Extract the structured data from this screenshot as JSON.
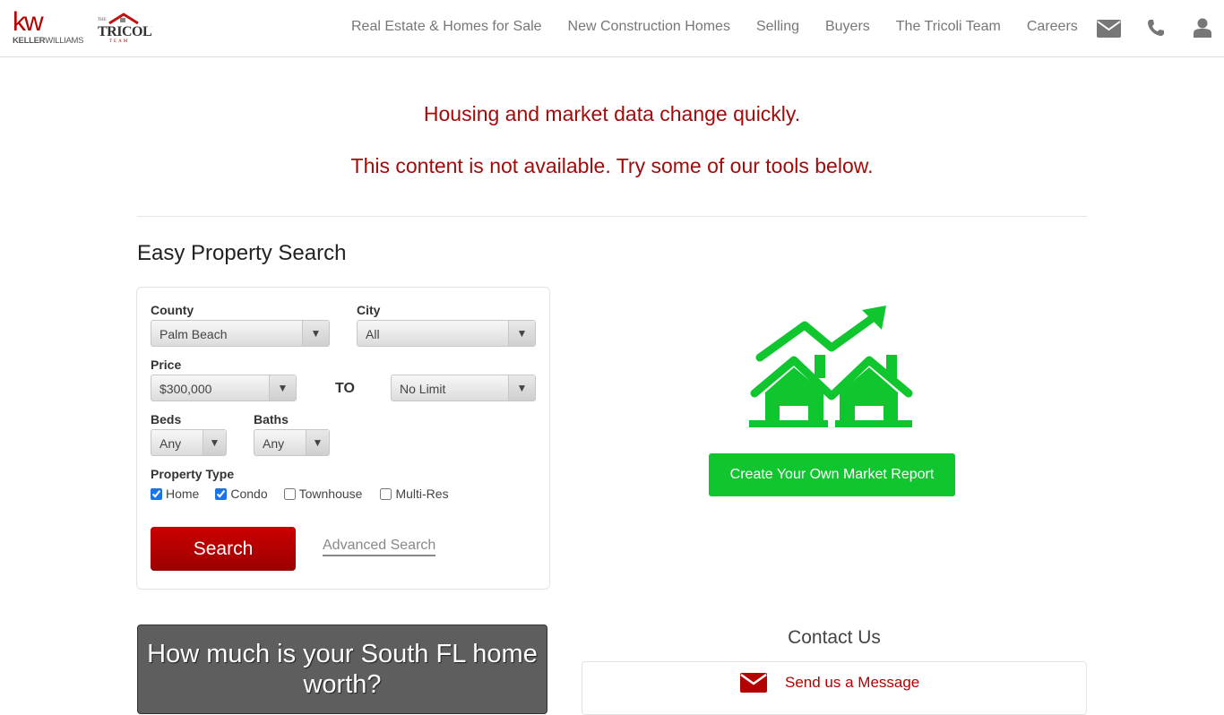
{
  "header": {
    "logo_kw_mark": "kw",
    "logo_kw_name_bold": "KELLER",
    "logo_kw_name_light": "WILLIAMS",
    "logo_tricoli_the": "THE",
    "logo_tricoli_name": "TRICOLI",
    "logo_tricoli_team": "TEAM",
    "nav": [
      {
        "label": "Real Estate & Homes for Sale"
      },
      {
        "label": "New Construction Homes"
      },
      {
        "label": "Selling"
      },
      {
        "label": "Buyers"
      },
      {
        "label": "The Tricoli Team"
      },
      {
        "label": "Careers"
      }
    ],
    "icons": [
      "envelope-icon",
      "phone-icon",
      "user-icon"
    ]
  },
  "notice": {
    "line1": "Housing and market data change quickly.",
    "line2": "This content is not available. Try some of our tools below."
  },
  "search": {
    "title": "Easy Property Search",
    "county_label": "County",
    "county_value": "Palm Beach",
    "city_label": "City",
    "city_value": "All",
    "price_label": "Price",
    "price_min": "$300,000",
    "price_to": "TO",
    "price_max": "No Limit",
    "beds_label": "Beds",
    "beds_value": "Any",
    "baths_label": "Baths",
    "baths_value": "Any",
    "property_type_label": "Property Type",
    "property_types": [
      {
        "label": "Home",
        "checked": true
      },
      {
        "label": "Condo",
        "checked": true
      },
      {
        "label": "Townhouse",
        "checked": false
      },
      {
        "label": "Multi-Res",
        "checked": false
      }
    ],
    "search_button": "Search",
    "advanced_link": "Advanced Search",
    "dropdown_arrow": "▼"
  },
  "market": {
    "button": "Create Your Own Market Report",
    "accent": "#10c62f"
  },
  "worth": {
    "text": "How much is your South FL home worth?"
  },
  "contact": {
    "title": "Contact Us",
    "message_link": "Send us a Message"
  },
  "colors": {
    "brand_red": "#b40101",
    "notice_red": "#a30a0a",
    "green": "#10c62f"
  }
}
